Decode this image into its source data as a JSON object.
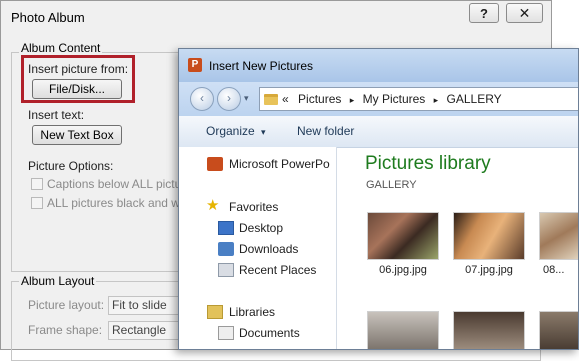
{
  "photo_album": {
    "title": "Photo Album",
    "help_icon": "?",
    "close_icon": "✕",
    "album_content": "Album Content",
    "insert_picture_from": "Insert picture from:",
    "file_disk_button": "File/Disk...",
    "insert_text": "Insert text:",
    "new_text_box_button": "New Text Box",
    "picture_options": "Picture Options:",
    "captions_option": "Captions below ALL pictures",
    "black_white_option": "ALL pictures black and white",
    "album_layout": "Album Layout",
    "picture_layout_label": "Picture layout:",
    "picture_layout_value": "Fit to slide",
    "frame_shape_label": "Frame shape:",
    "frame_shape_value": "Rectangle"
  },
  "insert_dialog": {
    "title": "Insert New Pictures",
    "back_icon": "‹",
    "forward_icon": "›",
    "breadcrumb": [
      "Pictures",
      "My Pictures",
      "GALLERY"
    ],
    "breadcrumb_prefix": "«",
    "breadcrumb_sep": "▸",
    "toolbar": {
      "organize": "Organize",
      "organize_arrow": "▾",
      "new_folder": "New folder"
    },
    "nav": {
      "powerpoint": "Microsoft PowerPo",
      "favorites": "Favorites",
      "desktop": "Desktop",
      "downloads": "Downloads",
      "recent_places": "Recent Places",
      "libraries": "Libraries",
      "documents": "Documents"
    },
    "library_title": "Pictures library",
    "library_subtitle": "GALLERY",
    "thumbnails": [
      "06.jpg.jpg",
      "07.jpg.jpg",
      "08..."
    ]
  },
  "colors": {
    "highlight": "#b0202a",
    "library_green": "#1e7b1e"
  }
}
